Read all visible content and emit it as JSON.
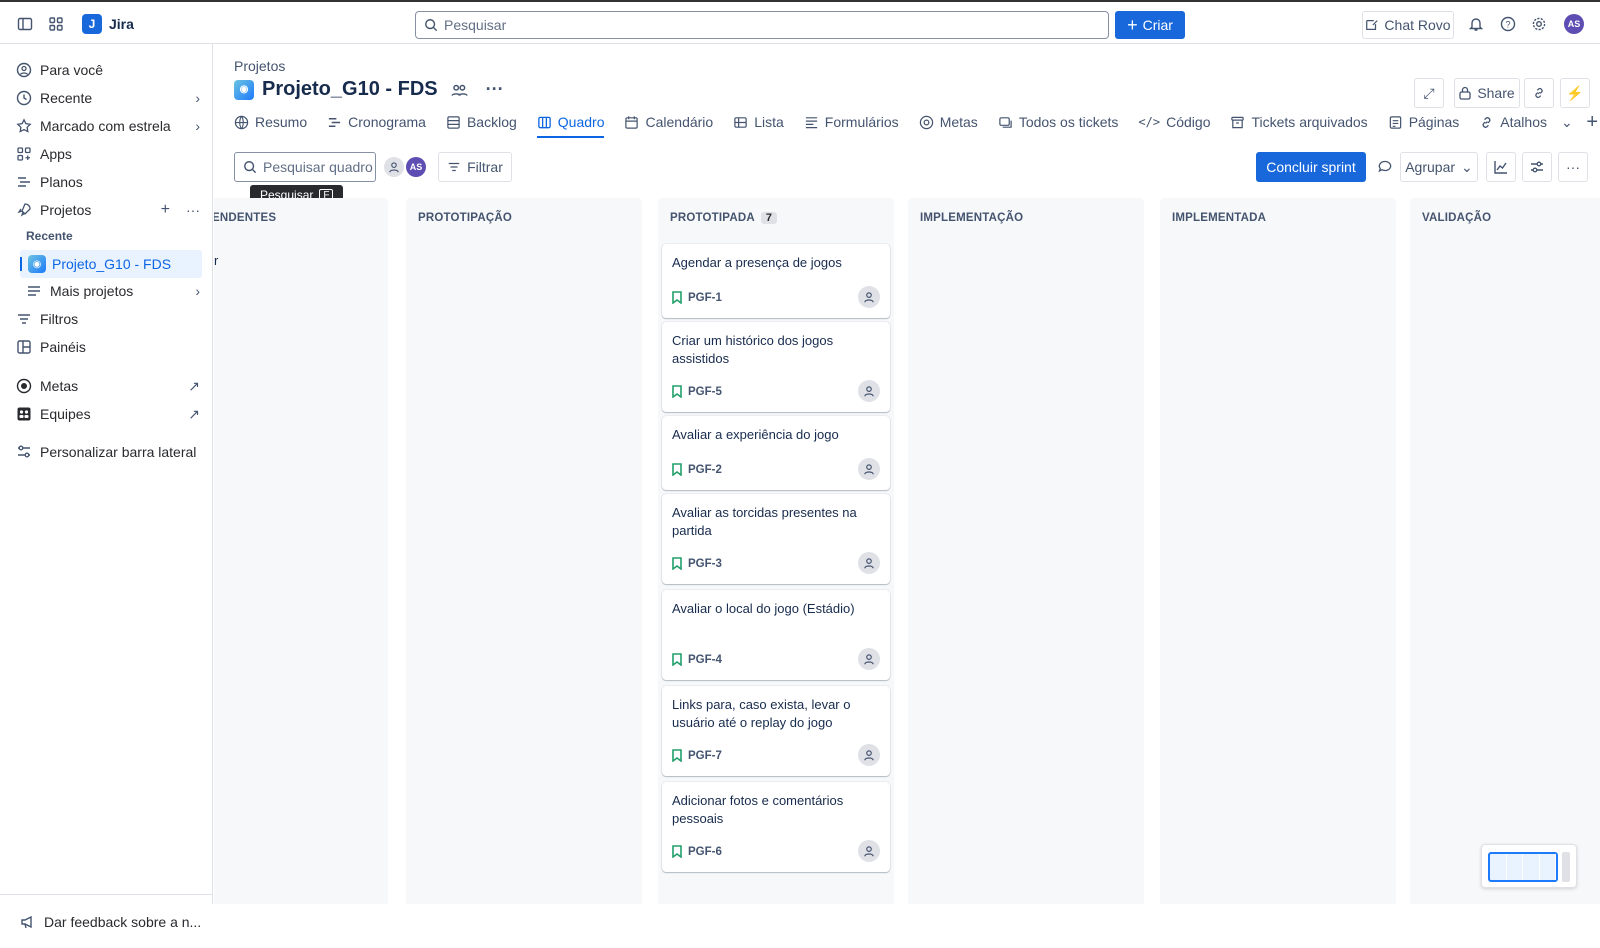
{
  "app": {
    "name": "Jira",
    "logo_letter": "J"
  },
  "topbar": {
    "search_placeholder": "Pesquisar",
    "create_label": "Criar",
    "chat_label": "Chat Rovo",
    "user_initials": "AS"
  },
  "sidebar": {
    "items": [
      {
        "label": "Para você"
      },
      {
        "label": "Recente"
      },
      {
        "label": "Marcado com estrela"
      },
      {
        "label": "Apps"
      },
      {
        "label": "Planos"
      },
      {
        "label": "Projetos"
      }
    ],
    "recent_section": "Recente",
    "active_project": "Projeto_G10 - FDS",
    "more_projects": "Mais projetos",
    "filters": "Filtros",
    "dashboards": "Painéis",
    "goals": "Metas",
    "teams": "Equipes",
    "customize": "Personalizar barra lateral",
    "feedback": "Dar feedback sobre a n..."
  },
  "header": {
    "breadcrumb": "Projetos",
    "title": "Projeto_G10 - FDS",
    "share_label": "Share"
  },
  "tabs": [
    {
      "label": "Resumo",
      "icon": "globe-icon"
    },
    {
      "label": "Cronograma",
      "icon": "timeline-icon"
    },
    {
      "label": "Backlog",
      "icon": "backlog-icon"
    },
    {
      "label": "Quadro",
      "icon": "board-icon",
      "active": true
    },
    {
      "label": "Calendário",
      "icon": "calendar-icon"
    },
    {
      "label": "Lista",
      "icon": "list-icon"
    },
    {
      "label": "Formulários",
      "icon": "forms-icon"
    },
    {
      "label": "Metas",
      "icon": "goal-icon"
    },
    {
      "label": "Todos os tickets",
      "icon": "tickets-icon"
    },
    {
      "label": "Código",
      "icon": "code-icon"
    },
    {
      "label": "Tickets arquivados",
      "icon": "archive-icon"
    },
    {
      "label": "Páginas",
      "icon": "pages-icon"
    },
    {
      "label": "Atalhos",
      "icon": "link-icon"
    }
  ],
  "toolbar": {
    "search_placeholder": "Pesquisar quadro",
    "avatar_initials": "AS",
    "filter_label": "Filtrar",
    "tooltip_label": "Pesquisar",
    "tooltip_key": "F",
    "complete_sprint": "Concluir sprint",
    "group_label": "Agrupar"
  },
  "board": {
    "columns": [
      {
        "title": "ENDENTES",
        "partial_text": "r"
      },
      {
        "title": "PROTOTIPAÇÃO"
      },
      {
        "title": "PROTOTIPADA",
        "count": "7"
      },
      {
        "title": "IMPLEMENTAÇÃO"
      },
      {
        "title": "IMPLEMENTADA"
      },
      {
        "title": "VALIDAÇÃO"
      }
    ],
    "cards": [
      {
        "title": "Agendar a presença de jogos",
        "key": "PGF-1"
      },
      {
        "title": "Criar um histórico dos jogos assistidos",
        "key": "PGF-5"
      },
      {
        "title": "Avaliar a experiência do jogo",
        "key": "PGF-2"
      },
      {
        "title": "Avaliar as torcidas presentes na partida",
        "key": "PGF-3"
      },
      {
        "title": "Avaliar o local do jogo (Estádio)",
        "key": "PGF-4"
      },
      {
        "title": "Links para, caso exista, levar o usuário até o replay do jogo",
        "key": "PGF-7"
      },
      {
        "title": "Adicionar fotos e comentários pessoais",
        "key": "PGF-6"
      }
    ]
  },
  "colors": {
    "accent": "#1868db",
    "column_bg": "#f7f8f9",
    "story_icon": "#22a06b"
  }
}
